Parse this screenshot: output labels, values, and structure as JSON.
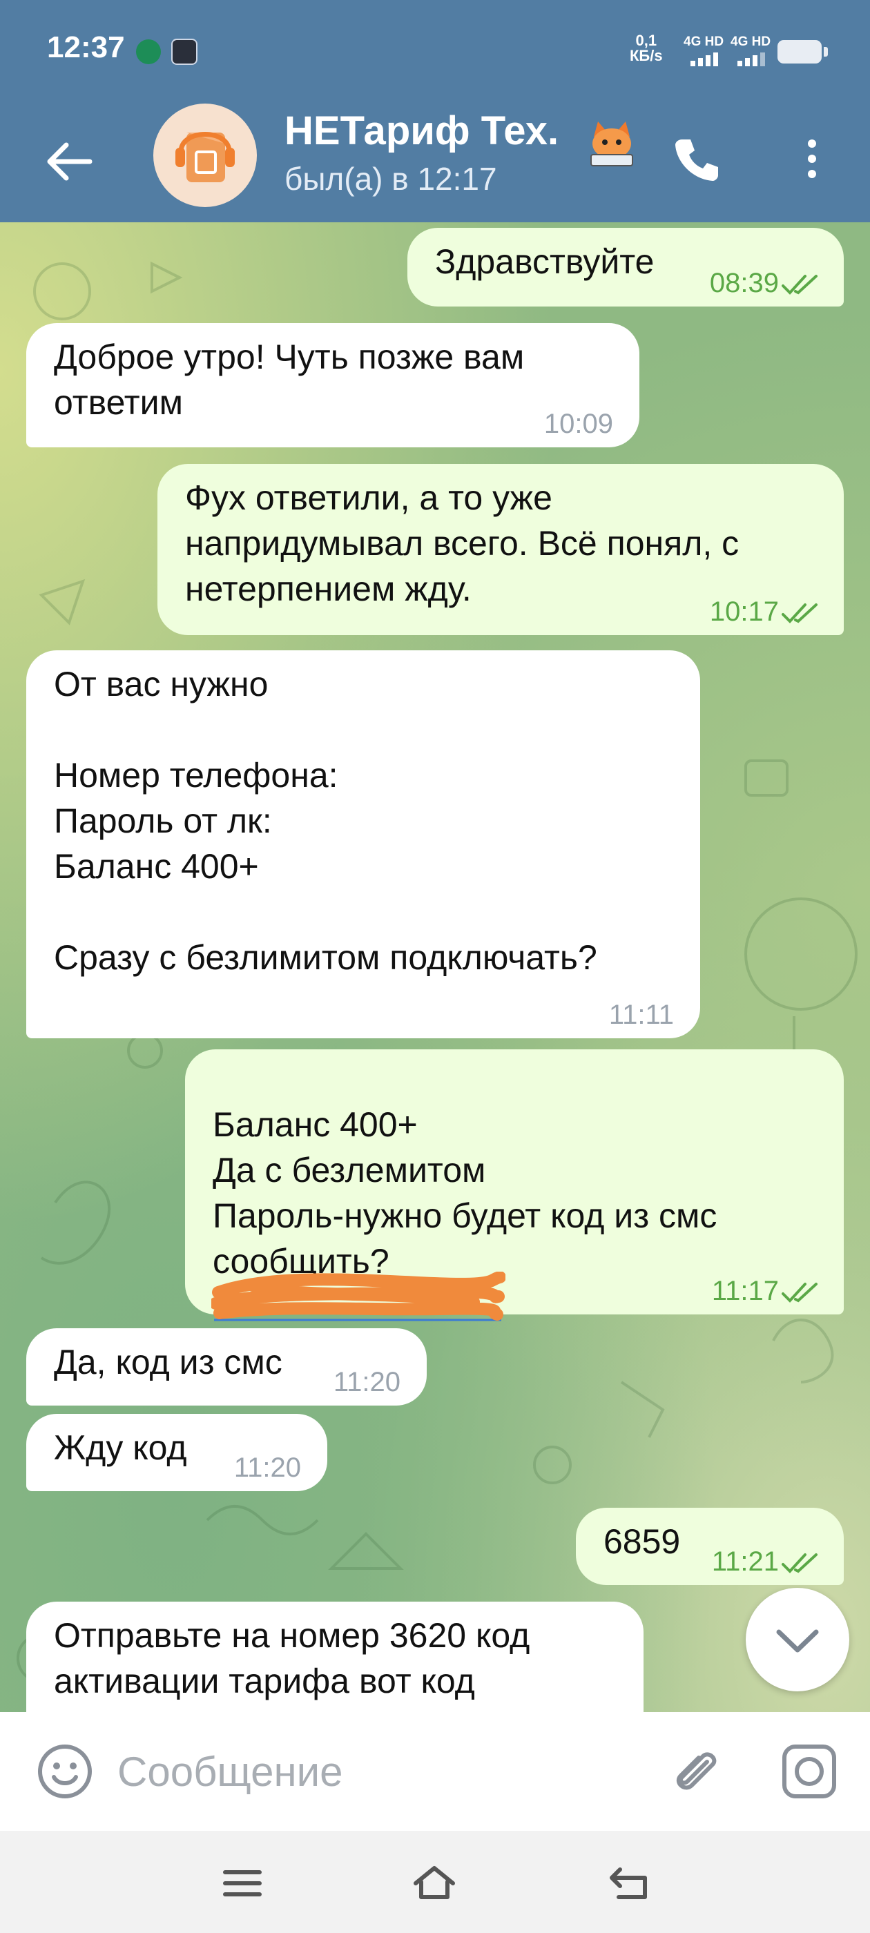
{
  "status_bar": {
    "time": "12:37",
    "speed_value": "0,1",
    "speed_unit": "КБ/s",
    "network_1": "4G HD",
    "network_2": "4G HD"
  },
  "header": {
    "chat_name": "НЕТариф Тех.",
    "chat_status": "был(а) в 12:17",
    "icons": [
      "back-icon",
      "avatar",
      "emoji-badge",
      "phone-icon",
      "more-icon"
    ]
  },
  "messages": [
    {
      "direction": "out",
      "text": "Здравствуйте",
      "time": "08:39",
      "read": true
    },
    {
      "direction": "in",
      "text": "Доброе утро! Чуть позже вам\nответим",
      "time": "10:09"
    },
    {
      "direction": "out",
      "text": "Фух ответили, а то уже\nнапридумывал всего. Всё понял, с\nнетерпением жду.",
      "time": "10:17",
      "read": true
    },
    {
      "direction": "in",
      "text": "От вас нужно\n\nНомер телефона:\nПароль от лк:\nБаланс 400+\n\nСразу с безлимитом подключать?",
      "time": "11:11"
    },
    {
      "direction": "out",
      "text": "Баланс 400+\nДа с безлемитом\nПароль-нужно будет код из смс\nсообщить?",
      "time": "11:17",
      "read": true,
      "redacted_link": true
    },
    {
      "direction": "in",
      "text": "Да, код из смс",
      "time": "11:20"
    },
    {
      "direction": "in",
      "text": "Жду код",
      "time": "11:20"
    },
    {
      "direction": "out",
      "text": "6859",
      "time": "11:21",
      "read": true
    },
    {
      "direction": "in",
      "text": "Отправьте на номер 3620 код\nактивации тарифа вот код",
      "time": ""
    }
  ],
  "composer": {
    "placeholder": "Сообщение",
    "value": "",
    "icons": [
      "emoji-icon",
      "attach-icon",
      "camera-icon"
    ]
  },
  "colors": {
    "header_bg": "#527da3",
    "bubble_in": "#ffffff",
    "bubble_out": "#effedd",
    "time_out": "#5aa846",
    "time_in": "#9aa3ad"
  }
}
